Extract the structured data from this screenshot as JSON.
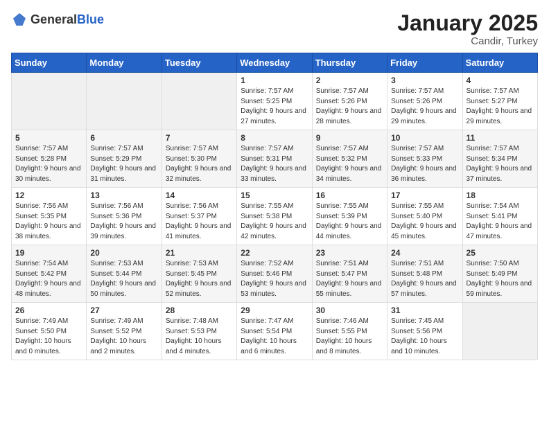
{
  "header": {
    "logo_general": "General",
    "logo_blue": "Blue",
    "month": "January 2025",
    "location": "Candir, Turkey"
  },
  "weekdays": [
    "Sunday",
    "Monday",
    "Tuesday",
    "Wednesday",
    "Thursday",
    "Friday",
    "Saturday"
  ],
  "weeks": [
    [
      {
        "day": "",
        "sunrise": "",
        "sunset": "",
        "daylight": ""
      },
      {
        "day": "",
        "sunrise": "",
        "sunset": "",
        "daylight": ""
      },
      {
        "day": "",
        "sunrise": "",
        "sunset": "",
        "daylight": ""
      },
      {
        "day": "1",
        "sunrise": "Sunrise: 7:57 AM",
        "sunset": "Sunset: 5:25 PM",
        "daylight": "Daylight: 9 hours and 27 minutes."
      },
      {
        "day": "2",
        "sunrise": "Sunrise: 7:57 AM",
        "sunset": "Sunset: 5:26 PM",
        "daylight": "Daylight: 9 hours and 28 minutes."
      },
      {
        "day": "3",
        "sunrise": "Sunrise: 7:57 AM",
        "sunset": "Sunset: 5:26 PM",
        "daylight": "Daylight: 9 hours and 29 minutes."
      },
      {
        "day": "4",
        "sunrise": "Sunrise: 7:57 AM",
        "sunset": "Sunset: 5:27 PM",
        "daylight": "Daylight: 9 hours and 29 minutes."
      }
    ],
    [
      {
        "day": "5",
        "sunrise": "Sunrise: 7:57 AM",
        "sunset": "Sunset: 5:28 PM",
        "daylight": "Daylight: 9 hours and 30 minutes."
      },
      {
        "day": "6",
        "sunrise": "Sunrise: 7:57 AM",
        "sunset": "Sunset: 5:29 PM",
        "daylight": "Daylight: 9 hours and 31 minutes."
      },
      {
        "day": "7",
        "sunrise": "Sunrise: 7:57 AM",
        "sunset": "Sunset: 5:30 PM",
        "daylight": "Daylight: 9 hours and 32 minutes."
      },
      {
        "day": "8",
        "sunrise": "Sunrise: 7:57 AM",
        "sunset": "Sunset: 5:31 PM",
        "daylight": "Daylight: 9 hours and 33 minutes."
      },
      {
        "day": "9",
        "sunrise": "Sunrise: 7:57 AM",
        "sunset": "Sunset: 5:32 PM",
        "daylight": "Daylight: 9 hours and 34 minutes."
      },
      {
        "day": "10",
        "sunrise": "Sunrise: 7:57 AM",
        "sunset": "Sunset: 5:33 PM",
        "daylight": "Daylight: 9 hours and 36 minutes."
      },
      {
        "day": "11",
        "sunrise": "Sunrise: 7:57 AM",
        "sunset": "Sunset: 5:34 PM",
        "daylight": "Daylight: 9 hours and 37 minutes."
      }
    ],
    [
      {
        "day": "12",
        "sunrise": "Sunrise: 7:56 AM",
        "sunset": "Sunset: 5:35 PM",
        "daylight": "Daylight: 9 hours and 38 minutes."
      },
      {
        "day": "13",
        "sunrise": "Sunrise: 7:56 AM",
        "sunset": "Sunset: 5:36 PM",
        "daylight": "Daylight: 9 hours and 39 minutes."
      },
      {
        "day": "14",
        "sunrise": "Sunrise: 7:56 AM",
        "sunset": "Sunset: 5:37 PM",
        "daylight": "Daylight: 9 hours and 41 minutes."
      },
      {
        "day": "15",
        "sunrise": "Sunrise: 7:55 AM",
        "sunset": "Sunset: 5:38 PM",
        "daylight": "Daylight: 9 hours and 42 minutes."
      },
      {
        "day": "16",
        "sunrise": "Sunrise: 7:55 AM",
        "sunset": "Sunset: 5:39 PM",
        "daylight": "Daylight: 9 hours and 44 minutes."
      },
      {
        "day": "17",
        "sunrise": "Sunrise: 7:55 AM",
        "sunset": "Sunset: 5:40 PM",
        "daylight": "Daylight: 9 hours and 45 minutes."
      },
      {
        "day": "18",
        "sunrise": "Sunrise: 7:54 AM",
        "sunset": "Sunset: 5:41 PM",
        "daylight": "Daylight: 9 hours and 47 minutes."
      }
    ],
    [
      {
        "day": "19",
        "sunrise": "Sunrise: 7:54 AM",
        "sunset": "Sunset: 5:42 PM",
        "daylight": "Daylight: 9 hours and 48 minutes."
      },
      {
        "day": "20",
        "sunrise": "Sunrise: 7:53 AM",
        "sunset": "Sunset: 5:44 PM",
        "daylight": "Daylight: 9 hours and 50 minutes."
      },
      {
        "day": "21",
        "sunrise": "Sunrise: 7:53 AM",
        "sunset": "Sunset: 5:45 PM",
        "daylight": "Daylight: 9 hours and 52 minutes."
      },
      {
        "day": "22",
        "sunrise": "Sunrise: 7:52 AM",
        "sunset": "Sunset: 5:46 PM",
        "daylight": "Daylight: 9 hours and 53 minutes."
      },
      {
        "day": "23",
        "sunrise": "Sunrise: 7:51 AM",
        "sunset": "Sunset: 5:47 PM",
        "daylight": "Daylight: 9 hours and 55 minutes."
      },
      {
        "day": "24",
        "sunrise": "Sunrise: 7:51 AM",
        "sunset": "Sunset: 5:48 PM",
        "daylight": "Daylight: 9 hours and 57 minutes."
      },
      {
        "day": "25",
        "sunrise": "Sunrise: 7:50 AM",
        "sunset": "Sunset: 5:49 PM",
        "daylight": "Daylight: 9 hours and 59 minutes."
      }
    ],
    [
      {
        "day": "26",
        "sunrise": "Sunrise: 7:49 AM",
        "sunset": "Sunset: 5:50 PM",
        "daylight": "Daylight: 10 hours and 0 minutes."
      },
      {
        "day": "27",
        "sunrise": "Sunrise: 7:49 AM",
        "sunset": "Sunset: 5:52 PM",
        "daylight": "Daylight: 10 hours and 2 minutes."
      },
      {
        "day": "28",
        "sunrise": "Sunrise: 7:48 AM",
        "sunset": "Sunset: 5:53 PM",
        "daylight": "Daylight: 10 hours and 4 minutes."
      },
      {
        "day": "29",
        "sunrise": "Sunrise: 7:47 AM",
        "sunset": "Sunset: 5:54 PM",
        "daylight": "Daylight: 10 hours and 6 minutes."
      },
      {
        "day": "30",
        "sunrise": "Sunrise: 7:46 AM",
        "sunset": "Sunset: 5:55 PM",
        "daylight": "Daylight: 10 hours and 8 minutes."
      },
      {
        "day": "31",
        "sunrise": "Sunrise: 7:45 AM",
        "sunset": "Sunset: 5:56 PM",
        "daylight": "Daylight: 10 hours and 10 minutes."
      },
      {
        "day": "",
        "sunrise": "",
        "sunset": "",
        "daylight": ""
      }
    ]
  ]
}
